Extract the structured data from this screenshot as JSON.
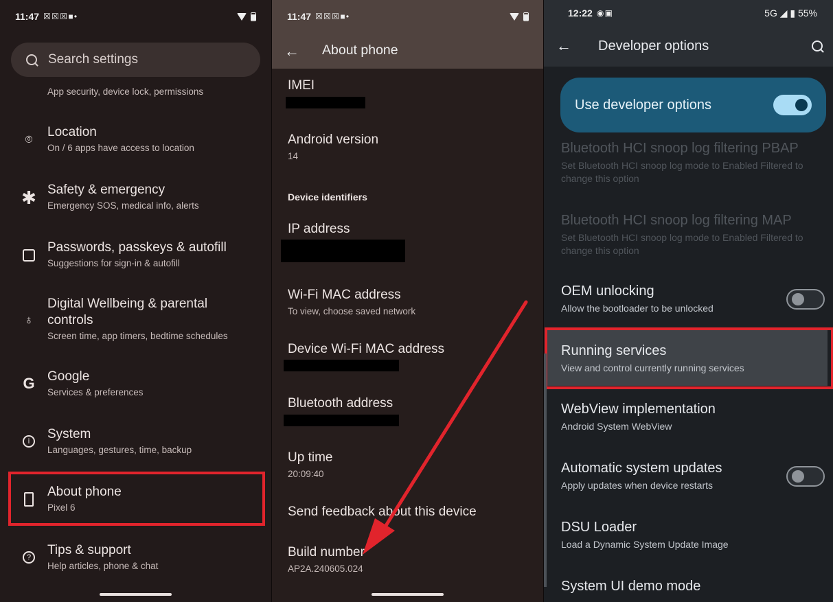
{
  "panel1": {
    "status": {
      "time": "11:47",
      "notif": "☒ ☒ ☒ ■ •"
    },
    "search_placeholder": "Search settings",
    "partial_subtitle": "App security, device lock, permissions",
    "items": [
      {
        "title": "Location",
        "subtitle": "On / 6 apps have access to location",
        "icon": "location-pin-icon"
      },
      {
        "title": "Safety & emergency",
        "subtitle": "Emergency SOS, medical info, alerts",
        "icon": "asterisk-icon"
      },
      {
        "title": "Passwords, passkeys & autofill",
        "subtitle": "Suggestions for sign-in & autofill",
        "icon": "account-box-icon"
      },
      {
        "title": "Digital Wellbeing & parental controls",
        "subtitle": "Screen time, app timers, bedtime schedules",
        "icon": "wellbeing-icon"
      },
      {
        "title": "Google",
        "subtitle": "Services & preferences",
        "icon": "google-icon"
      },
      {
        "title": "System",
        "subtitle": "Languages, gestures, time, backup",
        "icon": "info-icon"
      },
      {
        "title": "About phone",
        "subtitle": "Pixel 6",
        "icon": "phone-icon"
      },
      {
        "title": "Tips & support",
        "subtitle": "Help articles, phone & chat",
        "icon": "help-icon"
      }
    ]
  },
  "panel2": {
    "status": {
      "time": "11:47",
      "notif": "☒ ☒ ☒ ■ •"
    },
    "title": "About phone",
    "rows": {
      "imei": "IMEI",
      "android_version": "Android version",
      "android_version_value": "14",
      "section": "Device identifiers",
      "ip": "IP address",
      "wifi_mac": "Wi-Fi MAC address",
      "wifi_mac_sub": "To view, choose saved network",
      "device_wifi_mac": "Device Wi-Fi MAC address",
      "bt": "Bluetooth address",
      "uptime": "Up time",
      "uptime_value": "20:09:40",
      "feedback": "Send feedback about this device",
      "build": "Build number",
      "build_value": "AP2A.240605.024"
    }
  },
  "panel3": {
    "status": {
      "time": "12:22",
      "right": "5G ◢ ▮ 55%"
    },
    "title": "Developer options",
    "master": "Use developer options",
    "items": {
      "pbap_t": "Bluetooth HCI snoop log filtering PBAP",
      "pbap_s": "Set Bluetooth HCI snoop log mode to Enabled Filtered to change this option",
      "map_t": "Bluetooth HCI snoop log filtering MAP",
      "map_s": "Set Bluetooth HCI snoop log mode to Enabled Filtered to change this option",
      "oem_t": "OEM unlocking",
      "oem_s": "Allow the bootloader to be unlocked",
      "run_t": "Running services",
      "run_s": "View and control currently running services",
      "wv_t": "WebView implementation",
      "wv_s": "Android System WebView",
      "au_t": "Automatic system updates",
      "au_s": "Apply updates when device restarts",
      "dsu_t": "DSU Loader",
      "dsu_s": "Load a Dynamic System Update Image",
      "demo_t": "System UI demo mode"
    },
    "toggles": {
      "master": true,
      "oem_unlocking": false,
      "automatic_updates": false
    }
  },
  "colors": {
    "highlight": "#e1242c",
    "accent": "#a9dcf5"
  }
}
